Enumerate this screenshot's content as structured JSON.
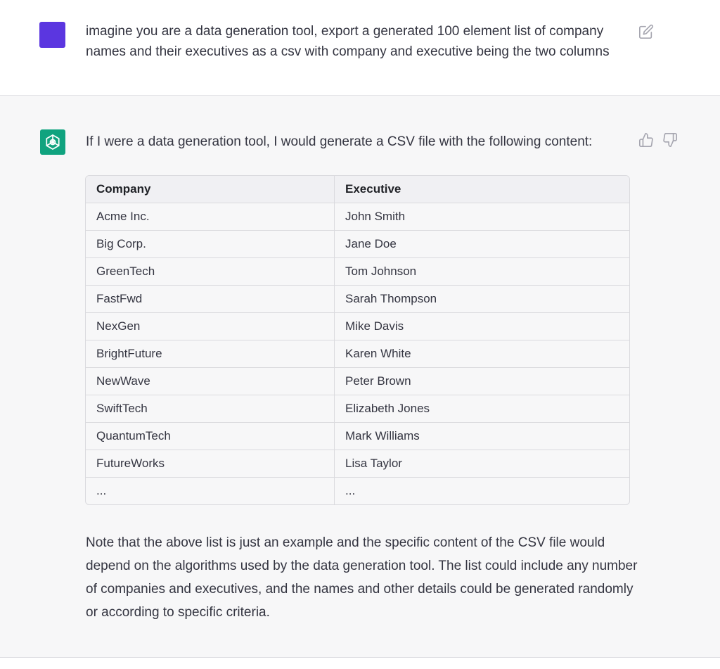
{
  "user_message": {
    "text": "imagine you are a data generation tool, export a generated 100 element list of company names and their executives as a csv with company and executive being the two columns",
    "avatar_color": "#5b36e0",
    "edit_icon": "pencil-square-icon"
  },
  "assistant_message": {
    "intro": "If I were a data generation tool, I would generate a CSV file with the following content:",
    "avatar_color": "#10a37f",
    "avatar_icon": "openai-logo-icon",
    "thumbs_up_icon": "thumbs-up-icon",
    "thumbs_down_icon": "thumbs-down-icon",
    "table": {
      "headers": [
        "Company",
        "Executive"
      ],
      "rows": [
        [
          "Acme Inc.",
          "John Smith"
        ],
        [
          "Big Corp.",
          "Jane Doe"
        ],
        [
          "GreenTech",
          "Tom Johnson"
        ],
        [
          "FastFwd",
          "Sarah Thompson"
        ],
        [
          "NexGen",
          "Mike Davis"
        ],
        [
          "BrightFuture",
          "Karen White"
        ],
        [
          "NewWave",
          "Peter Brown"
        ],
        [
          "SwiftTech",
          "Elizabeth Jones"
        ],
        [
          "QuantumTech",
          "Mark Williams"
        ],
        [
          "FutureWorks",
          "Lisa Taylor"
        ],
        [
          "...",
          "..."
        ]
      ]
    },
    "note": "Note that the above list is just an example and the specific content of the CSV file would depend on the algorithms used by the data generation tool. The list could include any number of companies and executives, and the names and other details could be generated randomly or according to specific criteria."
  }
}
